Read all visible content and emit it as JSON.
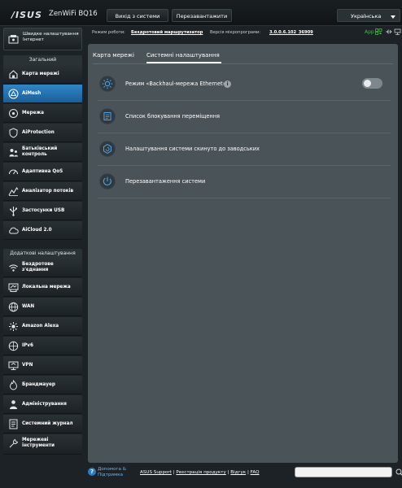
{
  "header": {
    "brand": "/ISUS",
    "model": "ZenWiFi BQ16",
    "logout_label": "Вихід з системи",
    "reboot_label": "Перезавантажити",
    "language": "Українська"
  },
  "infobar": {
    "mode_label": "Режим роботи:",
    "mode_value": "Бездротовий маршрутизатор",
    "firmware_label": "Версія мікропрограми:",
    "firmware_value": "3.0.0.6.102_36909",
    "app_label": "App"
  },
  "sidebar": {
    "quick_setup": "Швидке налаштування Інтернет",
    "general_title": "Загальний",
    "general_items": [
      {
        "label": "Карта мережі",
        "icon": "network-map-icon"
      },
      {
        "label": "AiMesh",
        "icon": "aimesh-icon",
        "active": true
      },
      {
        "label": "Мережа",
        "icon": "network-icon"
      },
      {
        "label": "AiProtection",
        "icon": "shield-icon"
      },
      {
        "label": "Батьківський контроль",
        "icon": "parental-control-icon"
      },
      {
        "label": "Адаптивна QoS",
        "icon": "qos-icon"
      },
      {
        "label": "Аналізатор потоків",
        "icon": "traffic-analyzer-icon"
      },
      {
        "label": "Застосунки USB",
        "icon": "usb-icon"
      },
      {
        "label": "AiCloud 2.0",
        "icon": "cloud-icon"
      }
    ],
    "advanced_title": "Додаткові налаштування",
    "advanced_items": [
      {
        "label": "Бездротове з'єднання",
        "icon": "wireless-icon"
      },
      {
        "label": "Локальна мережа",
        "icon": "lan-icon"
      },
      {
        "label": "WAN",
        "icon": "wan-icon"
      },
      {
        "label": "Amazon Alexa",
        "icon": "alexa-icon"
      },
      {
        "label": "IPv6",
        "icon": "ipv6-icon"
      },
      {
        "label": "VPN",
        "icon": "vpn-icon"
      },
      {
        "label": "Брандмауер",
        "icon": "firewall-icon"
      },
      {
        "label": "Адміністрування",
        "icon": "admin-icon"
      },
      {
        "label": "Системний журнал",
        "icon": "system-log-icon"
      },
      {
        "label": "Мережеві інструменти",
        "icon": "network-tools-icon"
      }
    ]
  },
  "main": {
    "tabs": [
      {
        "label": "Карта мережі"
      },
      {
        "label": "Системні налаштування",
        "active": true
      }
    ],
    "rows": [
      {
        "label": "Режим «Backhaul-мережа Ethernet»",
        "icon": "ethernet-backhaul-icon",
        "toggle": false
      },
      {
        "label": "Список блокування переміщення",
        "icon": "list-icon"
      },
      {
        "label": "Налаштування системи скинуто до заводських",
        "icon": "reset-icon"
      },
      {
        "label": "Перезавантаження системи",
        "icon": "reboot-icon"
      }
    ]
  },
  "footer": {
    "help_label": "Допомога & Підтримка",
    "links": [
      "ASUS Support",
      "Реєстрація продукту",
      "Відгук",
      "FAQ"
    ],
    "search_placeholder": ""
  },
  "colors": {
    "active": "#2a7bbf",
    "panel": "#4a5357",
    "background": "#1c2226",
    "app_green": "#3fbf3f"
  }
}
